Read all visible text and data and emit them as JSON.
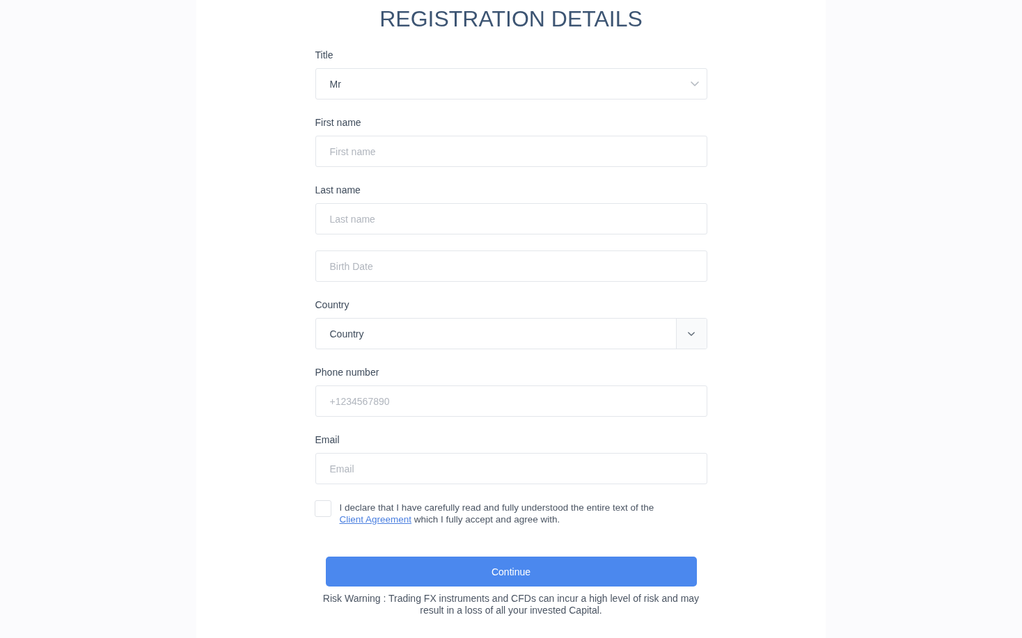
{
  "heading": "REGISTRATION DETAILS",
  "fields": [
    {
      "kind": "select",
      "label": "Title",
      "value": "Mr"
    },
    {
      "kind": "text",
      "label": "First name",
      "placeholder": "First name"
    },
    {
      "kind": "text",
      "label": "Last name",
      "placeholder": "Last name"
    },
    {
      "kind": "text",
      "placeholder": "Birth Date"
    },
    {
      "kind": "select_addon",
      "label": "Country",
      "value": "Country"
    },
    {
      "kind": "text",
      "label": "Phone number",
      "placeholder": "+1234567890"
    },
    {
      "kind": "text",
      "label": "Email",
      "placeholder": "Email"
    }
  ],
  "agreement": {
    "checked": false,
    "text_before": "I declare that I have carefully read and fully understood the entire text of the",
    "link": "Client Agreement",
    "text_after": "which I fully accept and agree with."
  },
  "continue_button": "Continue",
  "risk_warning": "Risk Warning : Trading FX instruments and CFDs can incur a high level of risk and may result in a loss of all your invested Capital."
}
